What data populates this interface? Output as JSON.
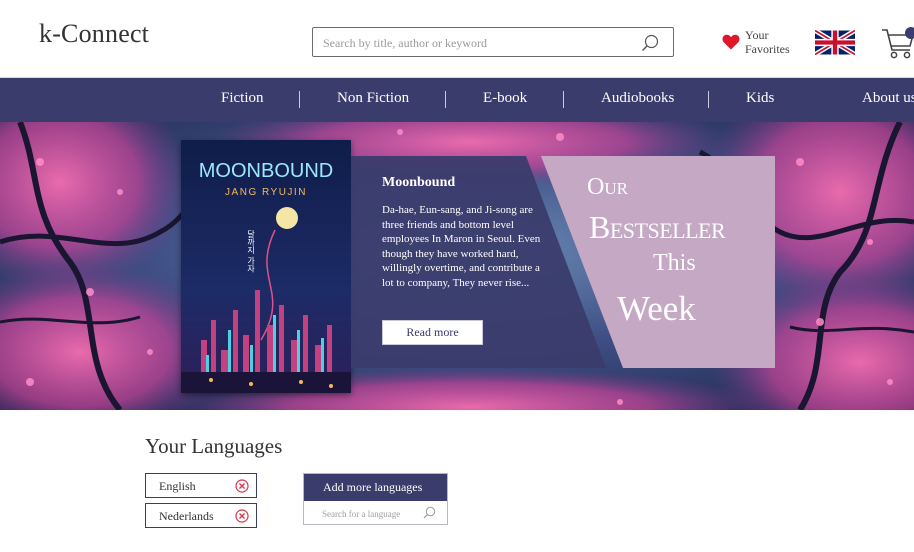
{
  "header": {
    "logo": "k-Connect",
    "search_placeholder": "Search by title, author or keyword",
    "favorites_line1": "Your",
    "favorites_line2": "Favorites",
    "language_flag": "uk-flag",
    "cart_icon": "cart-icon"
  },
  "nav": {
    "items": [
      {
        "label": "Fiction"
      },
      {
        "label": "Non Fiction"
      },
      {
        "label": "E-book"
      },
      {
        "label": "Audiobooks"
      },
      {
        "label": "Kids"
      },
      {
        "label": "About us"
      }
    ]
  },
  "hero": {
    "cover_title": "MOONBOUND",
    "cover_author": "JANG RYUJIN",
    "cover_korean": "달까지 가자",
    "book_title": "Moonbound",
    "description": "Da-hae, Eun-sang, and Ji-song are three friends and bottom level employees In Maron in Seoul. Even though they have worked hard, willingly overtime, and contribute a lot to company, They never rise...",
    "read_more": "Read more",
    "promo": {
      "our": "Our",
      "bestseller": "Bestseller",
      "this": "This",
      "week": "Week"
    }
  },
  "languages": {
    "heading": "Your Languages",
    "selected": [
      {
        "label": "English"
      },
      {
        "label": "Nederlands"
      }
    ],
    "add_button": "Add more languages",
    "search_placeholder": "Search for a language"
  },
  "colors": {
    "primary": "#3a3c6c",
    "promo": "#c4a8c4",
    "heart": "#e0162b",
    "remove": "#d6344a"
  }
}
